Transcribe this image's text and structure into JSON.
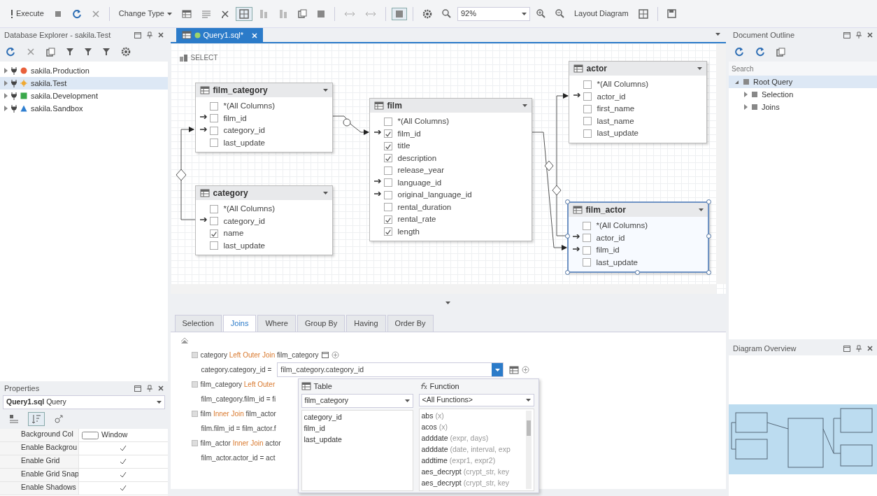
{
  "toolbar": [
    {
      "kind": "button",
      "label": "Execute"
    },
    {
      "kind": "stop",
      "selected": false
    },
    {
      "kind": "refresh",
      "selected": false
    },
    {
      "kind": "cancel",
      "selected": false
    },
    {
      "kind": "separator"
    },
    {
      "kind": "dropdown",
      "label": "Change Type"
    },
    {
      "kind": "table",
      "selected": false
    },
    {
      "kind": "list",
      "selected": false
    },
    {
      "kind": "pencil",
      "selected": false
    },
    {
      "kind": "grid",
      "selected": true
    },
    {
      "kind": "columns",
      "selected": false
    },
    {
      "kind": "columns",
      "selected": false
    },
    {
      "kind": "copy",
      "selected": false
    },
    {
      "kind": "square",
      "selected": false
    },
    {
      "kind": "separator"
    },
    {
      "kind": "arrows",
      "selected": false
    },
    {
      "kind": "arrows",
      "selected": false
    },
    {
      "kind": "separator"
    },
    {
      "kind": "square",
      "selected": true
    },
    {
      "kind": "separator"
    },
    {
      "kind": "gear",
      "selected": false
    },
    {
      "kind": "search",
      "selected": false
    },
    {
      "kind": "combo",
      "value": "92%"
    },
    {
      "kind": "zoomin",
      "selected": false
    },
    {
      "kind": "zoomout",
      "selected": false
    },
    {
      "kind": "button",
      "label": "Layout Diagram"
    },
    {
      "kind": "grid",
      "selected": false
    },
    {
      "kind": "separator"
    },
    {
      "kind": "save",
      "selected": false
    }
  ],
  "db_explorer": {
    "title": "Database Explorer - sakila.Test",
    "items": [
      {
        "label": "sakila.Production",
        "color": "#e8603c",
        "kind": "circle",
        "expanded": false,
        "selected": false
      },
      {
        "label": "sakila.Test",
        "color": "#f0a830",
        "kind": "sun",
        "expanded": false,
        "selected": true
      },
      {
        "label": "sakila.Development",
        "color": "#3aa84a",
        "kind": "square",
        "expanded": false,
        "selected": false
      },
      {
        "label": "sakila.Sandbox",
        "color": "#2f7fd0",
        "kind": "triangle",
        "expanded": false,
        "selected": false
      }
    ]
  },
  "properties": {
    "title": "Properties",
    "object": "Query1.sql",
    "object_type": "Query",
    "view_modes": [
      {
        "kind": "categorized",
        "selected": false
      },
      {
        "kind": "alphabetical",
        "selected": true
      },
      {
        "kind": "events",
        "selected": false
      }
    ],
    "rows": [
      {
        "kind": "color",
        "name": "Background Col",
        "value": "Window"
      },
      {
        "kind": "check",
        "name": "Enable Backgrou",
        "checked": true
      },
      {
        "kind": "check",
        "name": "Enable Grid",
        "checked": true
      },
      {
        "kind": "check",
        "name": "Enable Grid Snap",
        "checked": true
      },
      {
        "kind": "check",
        "name": "Enable Shadows",
        "checked": true
      }
    ]
  },
  "doc_tabs": [
    {
      "label": "Query1.sql*",
      "selected": true
    }
  ],
  "diagram": {
    "select_label": "SELECT",
    "tables": [
      {
        "name": "film_category",
        "selected": false,
        "columns": [
          {
            "name": "*(All Columns)",
            "checked": false,
            "linked": false
          },
          {
            "name": "film_id",
            "checked": false,
            "linked": true
          },
          {
            "name": "category_id",
            "checked": false,
            "linked": true
          },
          {
            "name": "last_update",
            "checked": false,
            "linked": false
          }
        ]
      },
      {
        "name": "category",
        "selected": false,
        "columns": [
          {
            "name": "*(All Columns)",
            "checked": false,
            "linked": false
          },
          {
            "name": "category_id",
            "checked": false,
            "linked": true
          },
          {
            "name": "name",
            "checked": true,
            "linked": false
          },
          {
            "name": "last_update",
            "checked": false,
            "linked": false
          }
        ]
      },
      {
        "name": "film",
        "selected": false,
        "columns": [
          {
            "name": "*(All Columns)",
            "checked": false,
            "linked": false
          },
          {
            "name": "film_id",
            "checked": true,
            "linked": true
          },
          {
            "name": "title",
            "checked": true,
            "linked": false
          },
          {
            "name": "description",
            "checked": true,
            "linked": false
          },
          {
            "name": "release_year",
            "checked": false,
            "linked": false
          },
          {
            "name": "language_id",
            "checked": false,
            "linked": true
          },
          {
            "name": "original_language_id",
            "checked": false,
            "linked": true
          },
          {
            "name": "rental_duration",
            "checked": false,
            "linked": false
          },
          {
            "name": "rental_rate",
            "checked": true,
            "linked": false
          },
          {
            "name": "length",
            "checked": true,
            "linked": false
          }
        ]
      },
      {
        "name": "actor",
        "selected": false,
        "columns": [
          {
            "name": "*(All Columns)",
            "checked": false,
            "linked": false
          },
          {
            "name": "actor_id",
            "checked": false,
            "linked": true
          },
          {
            "name": "first_name",
            "checked": false,
            "linked": false
          },
          {
            "name": "last_name",
            "checked": false,
            "linked": false
          },
          {
            "name": "last_update",
            "checked": false,
            "linked": false
          }
        ]
      },
      {
        "name": "film_actor",
        "selected": true,
        "columns": [
          {
            "name": "*(All Columns)",
            "checked": false,
            "linked": false
          },
          {
            "name": "actor_id",
            "checked": false,
            "linked": true
          },
          {
            "name": "film_id",
            "checked": false,
            "linked": true
          },
          {
            "name": "last_update",
            "checked": false,
            "linked": false
          }
        ]
      }
    ]
  },
  "query_tabs": [
    {
      "label": "Selection",
      "selected": false
    },
    {
      "label": "Joins",
      "selected": true
    },
    {
      "label": "Where",
      "selected": false
    },
    {
      "label": "Group By",
      "selected": false
    },
    {
      "label": "Having",
      "selected": false
    },
    {
      "label": "Order By",
      "selected": false
    }
  ],
  "joins": [
    {
      "left": "category",
      "type": "Left Outer Join",
      "right": "film_category",
      "condition": "category.category_id =",
      "value": "film_category.category_id"
    },
    {
      "left": "film_category",
      "type": "Left Outer",
      "condition": "film_category.film_id = fi"
    },
    {
      "left": "film",
      "type": "Inner Join",
      "right": "film_actor",
      "condition": "film.film_id = film_actor.f"
    },
    {
      "left": "film_actor",
      "type": "Inner Join",
      "right": "actor",
      "condition": "film_actor.actor_id = act"
    }
  ],
  "popup": {
    "table_header": "Table",
    "table_value": "film_category",
    "columns": [
      "category_id",
      "film_id",
      "last_update"
    ],
    "function_header": "Function",
    "function_value": "<All Functions>",
    "functions": [
      {
        "name": "abs",
        "args": "(x)"
      },
      {
        "name": "acos",
        "args": "(x)"
      },
      {
        "name": "adddate",
        "args": "(expr, days)"
      },
      {
        "name": "adddate",
        "args": "(date, interval, exp"
      },
      {
        "name": "addtime",
        "args": "(expr1, expr2)"
      },
      {
        "name": "aes_decrypt",
        "args": "(crypt_str, key"
      },
      {
        "name": "aes_decrypt",
        "args": "(crypt_str, key"
      }
    ]
  },
  "outline": {
    "title": "Document Outline",
    "search_placeholder": "Search",
    "items": [
      {
        "label": "Root Query",
        "expanded": true,
        "selected": true,
        "children": [
          {
            "label": "Selection",
            "expanded": false,
            "selected": false
          },
          {
            "label": "Joins",
            "expanded": false,
            "selected": false
          }
        ]
      }
    ]
  },
  "overview": {
    "title": "Diagram Overview"
  }
}
